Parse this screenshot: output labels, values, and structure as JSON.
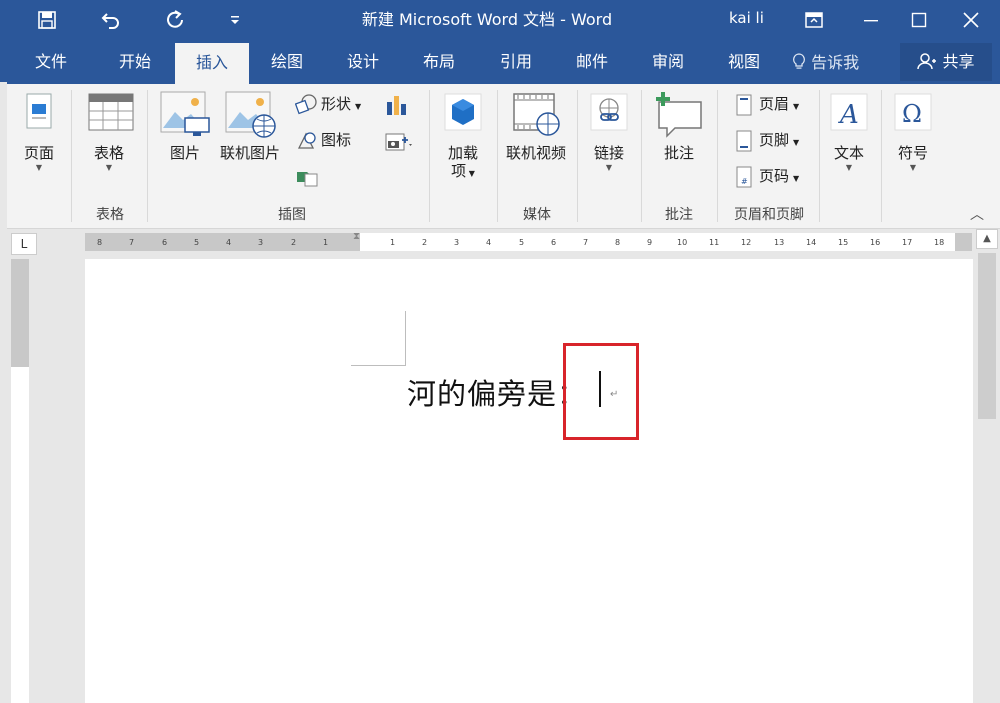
{
  "window": {
    "title": "新建 Microsoft Word 文档  -  Word",
    "user": "kai li",
    "qat": [
      "save-icon",
      "undo-icon",
      "redo-icon",
      "customize-qat-icon"
    ],
    "controls": [
      "ribbon-display-icon",
      "minimize-icon",
      "maximize-icon",
      "close-icon"
    ]
  },
  "tabs": [
    {
      "label": "文件",
      "active": false
    },
    {
      "label": "开始",
      "active": false
    },
    {
      "label": "插入",
      "active": true
    },
    {
      "label": "绘图",
      "active": false
    },
    {
      "label": "设计",
      "active": false
    },
    {
      "label": "布局",
      "active": false
    },
    {
      "label": "引用",
      "active": false
    },
    {
      "label": "邮件",
      "active": false
    },
    {
      "label": "审阅",
      "active": false
    },
    {
      "label": "视图",
      "active": false
    }
  ],
  "tell_me": "告诉我",
  "share": "共享",
  "ribbon": {
    "pages": {
      "label": "页面",
      "group": ""
    },
    "tables": {
      "label": "表格",
      "group": "表格"
    },
    "illustrations": {
      "group": "插图",
      "pictures": "图片",
      "online_pictures": "联机图片",
      "shapes": "形状",
      "icons": "图标"
    },
    "addins": {
      "label": "加载",
      "label2": "项"
    },
    "media": {
      "label": "联机视频",
      "group": "媒体"
    },
    "links": {
      "label": "链接"
    },
    "comments": {
      "label": "批注",
      "group": "批注"
    },
    "header_footer": {
      "group": "页眉和页脚",
      "header": "页眉",
      "footer": "页脚",
      "page_number": "页码"
    },
    "text": {
      "label": "文本"
    },
    "symbols": {
      "label": "符号"
    }
  },
  "ruler": {
    "corner": "L",
    "left_ticks": [
      "8",
      "7",
      "6",
      "5",
      "4",
      "3",
      "2",
      "1"
    ],
    "right_ticks": [
      "1",
      "2",
      "3",
      "4",
      "5",
      "6",
      "7",
      "8",
      "9",
      "10",
      "11",
      "12",
      "13",
      "14",
      "15",
      "16",
      "17",
      "18"
    ]
  },
  "document": {
    "text": "河的偏旁是：",
    "paragraph_mark": "↵"
  },
  "colors": {
    "brand": "#2b579a",
    "highlight": "#d8242a"
  }
}
